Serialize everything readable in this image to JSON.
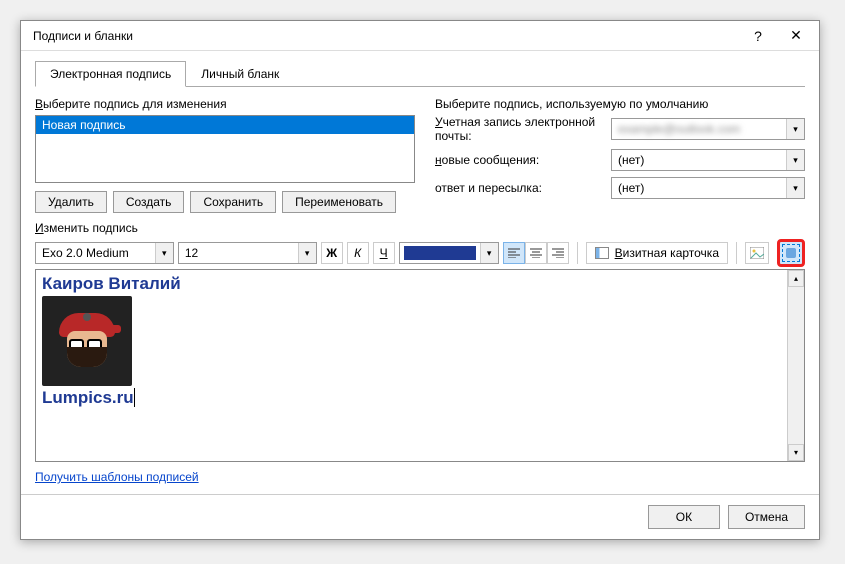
{
  "window": {
    "title": "Подписи и бланки"
  },
  "tabs": {
    "sigTab": "Электронная подпись",
    "blankTab": "Личный бланк"
  },
  "left": {
    "selectLabelPrefix": "В",
    "selectLabelRest": "ыберите подпись для изменения",
    "signatures": [
      "Новая подпись"
    ],
    "delete": "Удалить",
    "create": "Создать",
    "save": "Сохранить",
    "rename": "Переименовать"
  },
  "right": {
    "heading": "Выберите подпись, используемую по умолчанию",
    "accountPrefix": "У",
    "accountRest": "четная запись электронной почты:",
    "accountValue": "example@outlook.com",
    "newMsgPrefix": "н",
    "newMsgRest": "овые сообщения:",
    "newMsgValue": "(нет)",
    "replyLabel": "ответ и пересылка:",
    "replyValue": "(нет)"
  },
  "edit": {
    "labelPrefix": "И",
    "labelRest": "зменить подпись"
  },
  "toolbar": {
    "font": "Exo 2.0 Medium",
    "size": "12",
    "bold": "Ж",
    "italic": "К",
    "underline": "Ч",
    "vcardPrefix": "В",
    "vcardRest": "изитная карточка"
  },
  "editor": {
    "name": "Каиров Виталий",
    "site": "Lumpics.ru"
  },
  "link": "Получить шаблоны подписей",
  "footer": {
    "ok": "ОК",
    "cancel": "Отмена"
  }
}
